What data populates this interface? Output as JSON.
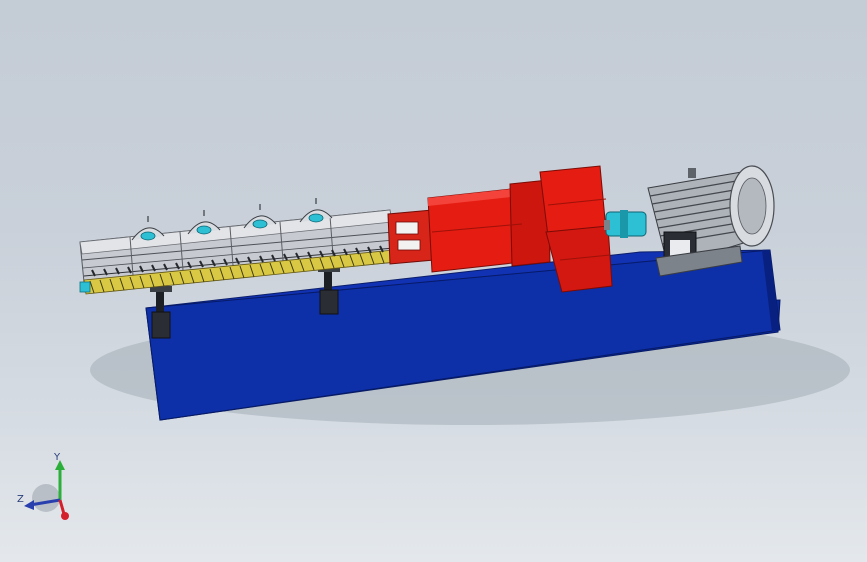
{
  "viewport": {
    "title": "",
    "background_top": "#c4ccd6",
    "background_bottom": "#e4e8ec"
  },
  "model": {
    "base_color": "#0b2fa0",
    "gearbox_color": "#e01a12",
    "motor_color": "#b7bcc2",
    "coupling_color": "#2dbfd4",
    "barrel_color": "#c9ccd2",
    "screw_color": "#e8d84a",
    "support_count": 2,
    "vent_count": 4
  },
  "triad": {
    "x_label": "",
    "y_label": "Y",
    "z_label": "Z",
    "x_color": "#d4202a",
    "y_color": "#2cae3a",
    "z_color": "#2a3fae"
  }
}
